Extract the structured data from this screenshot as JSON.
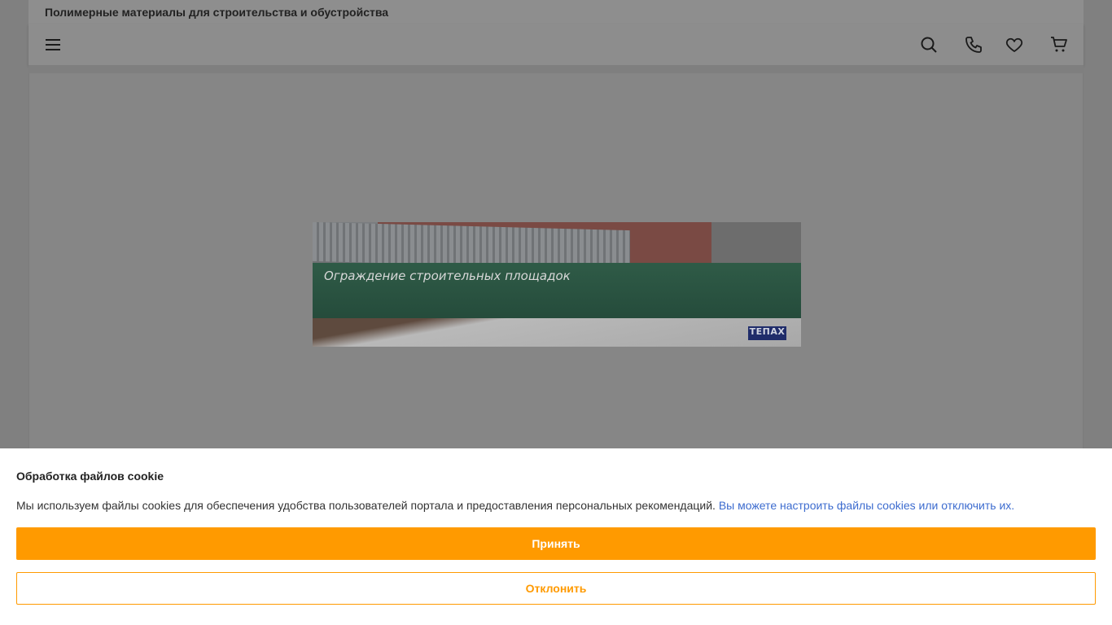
{
  "header": {
    "site_title": "Полимерные материалы для строительства и обустройства"
  },
  "navbar": {
    "icons": [
      "menu-icon",
      "search-icon",
      "phone-icon",
      "heart-icon",
      "cart-icon"
    ]
  },
  "banner": {
    "caption": "Ограждение строительных площадок",
    "logo_text": "ТЕПАХ"
  },
  "cookie": {
    "title": "Обработка файлов cookie",
    "text": "Мы используем файлы cookies для обеспечения удобства пользователей портала и предоставления персональных рекомендаций.",
    "link_text": "Вы можете настроить файлы cookies или отключить их.",
    "accept_label": "Принять",
    "reject_label": "Отклонить"
  },
  "colors": {
    "accent": "#ff9a00",
    "link": "#3d6ccf"
  }
}
